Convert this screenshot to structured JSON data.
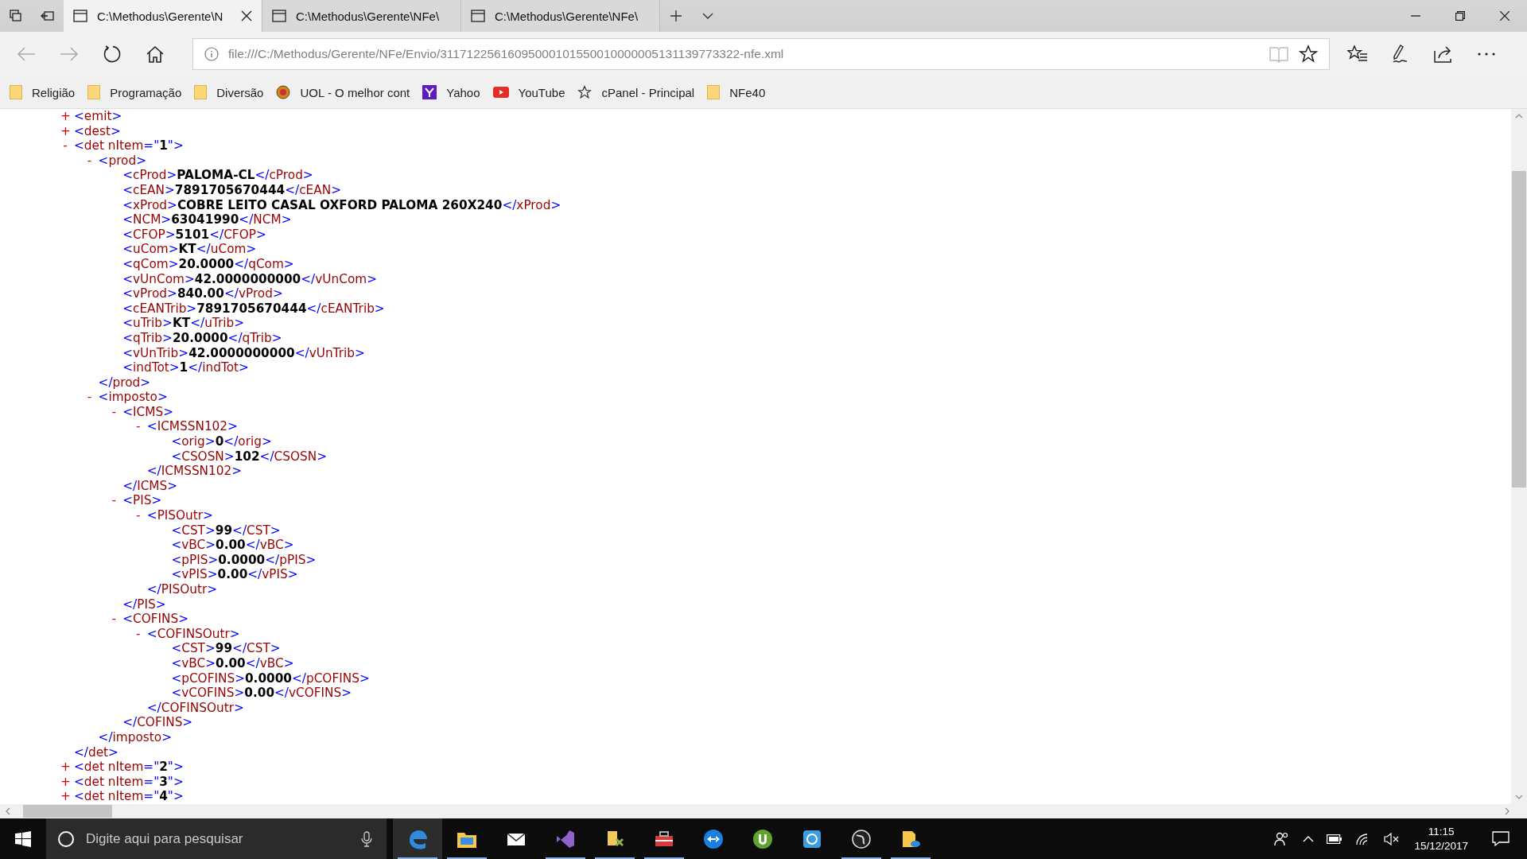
{
  "browser": {
    "tabs": [
      {
        "title": "C:\\Methodus\\Gerente\\N",
        "selected": true
      },
      {
        "title": "C:\\Methodus\\Gerente\\NFe\\",
        "selected": false
      },
      {
        "title": "C:\\Methodus\\Gerente\\NFe\\",
        "selected": false
      }
    ],
    "address": "file:///C:/Methodus/Gerente/NFe/Envio/31171225616095000101550010000005131139773322-nfe.xml",
    "favorites": [
      {
        "label": "Religião",
        "kind": "folder"
      },
      {
        "label": "Programação",
        "kind": "folder"
      },
      {
        "label": "Diversão",
        "kind": "folder"
      },
      {
        "label": "UOL - O melhor cont",
        "kind": "site"
      },
      {
        "label": "Yahoo",
        "kind": "yahoo"
      },
      {
        "label": "YouTube",
        "kind": "video"
      },
      {
        "label": "cPanel - Principal",
        "kind": "star"
      },
      {
        "label": "NFe40",
        "kind": "folder"
      }
    ]
  },
  "document": {
    "nodes": [
      {
        "toggle": "+",
        "open": "<emit>"
      },
      {
        "toggle": "+",
        "open": "<dest>"
      },
      {
        "toggle": "-",
        "open": "<det nItem=\"1\">",
        "close": "</det>",
        "children": [
          {
            "toggle": "-",
            "open": "<prod>",
            "close": "</prod>",
            "children": [
              {
                "open": "<cProd>",
                "value": "PALOMA-CL",
                "close": "</cProd>"
              },
              {
                "open": "<cEAN>",
                "value": "7891705670444",
                "close": "</cEAN>"
              },
              {
                "open": "<xProd>",
                "value": "COBRE LEITO CASAL OXFORD PALOMA 260X240",
                "close": "</xProd>"
              },
              {
                "open": "<NCM>",
                "value": "63041990",
                "close": "</NCM>"
              },
              {
                "open": "<CFOP>",
                "value": "5101",
                "close": "</CFOP>"
              },
              {
                "open": "<uCom>",
                "value": "KT",
                "close": "</uCom>"
              },
              {
                "open": "<qCom>",
                "value": "20.0000",
                "close": "</qCom>"
              },
              {
                "open": "<vUnCom>",
                "value": "42.0000000000",
                "close": "</vUnCom>"
              },
              {
                "open": "<vProd>",
                "value": "840.00",
                "close": "</vProd>"
              },
              {
                "open": "<cEANTrib>",
                "value": "7891705670444",
                "close": "</cEANTrib>"
              },
              {
                "open": "<uTrib>",
                "value": "KT",
                "close": "</uTrib>"
              },
              {
                "open": "<qTrib>",
                "value": "20.0000",
                "close": "</qTrib>"
              },
              {
                "open": "<vUnTrib>",
                "value": "42.0000000000",
                "close": "</vUnTrib>"
              },
              {
                "open": "<indTot>",
                "value": "1",
                "close": "</indTot>"
              }
            ]
          },
          {
            "toggle": "-",
            "open": "<imposto>",
            "close": "</imposto>",
            "children": [
              {
                "toggle": "-",
                "open": "<ICMS>",
                "close": "</ICMS>",
                "children": [
                  {
                    "toggle": "-",
                    "open": "<ICMSSN102>",
                    "close": "</ICMSSN102>",
                    "children": [
                      {
                        "open": "<orig>",
                        "value": "0",
                        "close": "</orig>"
                      },
                      {
                        "open": "<CSOSN>",
                        "value": "102",
                        "close": "</CSOSN>"
                      }
                    ]
                  }
                ]
              },
              {
                "toggle": "-",
                "open": "<PIS>",
                "close": "</PIS>",
                "children": [
                  {
                    "toggle": "-",
                    "open": "<PISOutr>",
                    "close": "</PISOutr>",
                    "children": [
                      {
                        "open": "<CST>",
                        "value": "99",
                        "close": "</CST>"
                      },
                      {
                        "open": "<vBC>",
                        "value": "0.00",
                        "close": "</vBC>"
                      },
                      {
                        "open": "<pPIS>",
                        "value": "0.0000",
                        "close": "</pPIS>"
                      },
                      {
                        "open": "<vPIS>",
                        "value": "0.00",
                        "close": "</vPIS>"
                      }
                    ]
                  }
                ]
              },
              {
                "toggle": "-",
                "open": "<COFINS>",
                "close": "</COFINS>",
                "children": [
                  {
                    "toggle": "-",
                    "open": "<COFINSOutr>",
                    "close": "</COFINSOutr>",
                    "children": [
                      {
                        "open": "<CST>",
                        "value": "99",
                        "close": "</CST>"
                      },
                      {
                        "open": "<vBC>",
                        "value": "0.00",
                        "close": "</vBC>"
                      },
                      {
                        "open": "<pCOFINS>",
                        "value": "0.0000",
                        "close": "</pCOFINS>"
                      },
                      {
                        "open": "<vCOFINS>",
                        "value": "0.00",
                        "close": "</vCOFINS>"
                      }
                    ]
                  }
                ]
              }
            ]
          }
        ]
      },
      {
        "toggle": "+",
        "open": "<det nItem=\"2\">"
      },
      {
        "toggle": "+",
        "open": "<det nItem=\"3\">"
      },
      {
        "toggle": "+",
        "open": "<det nItem=\"4\">"
      }
    ]
  },
  "taskbar": {
    "search_placeholder": "Digite aqui para pesquisar",
    "apps": [
      {
        "kind": "edge",
        "running": true,
        "selected": true
      },
      {
        "kind": "explorer",
        "running": true,
        "selected": false
      },
      {
        "kind": "mail",
        "running": false,
        "selected": false
      },
      {
        "kind": "code",
        "running": true,
        "selected": false
      },
      {
        "kind": "tools",
        "running": true,
        "selected": false
      },
      {
        "kind": "toolbox",
        "running": true,
        "selected": false
      },
      {
        "kind": "remote",
        "running": false,
        "selected": false
      },
      {
        "kind": "torrent",
        "running": false,
        "selected": false
      },
      {
        "kind": "browser",
        "running": false,
        "selected": false
      },
      {
        "kind": "globe",
        "running": true,
        "selected": false
      },
      {
        "kind": "files",
        "running": true,
        "selected": false
      }
    ],
    "time": "11:15",
    "date": "15/12/2017"
  }
}
